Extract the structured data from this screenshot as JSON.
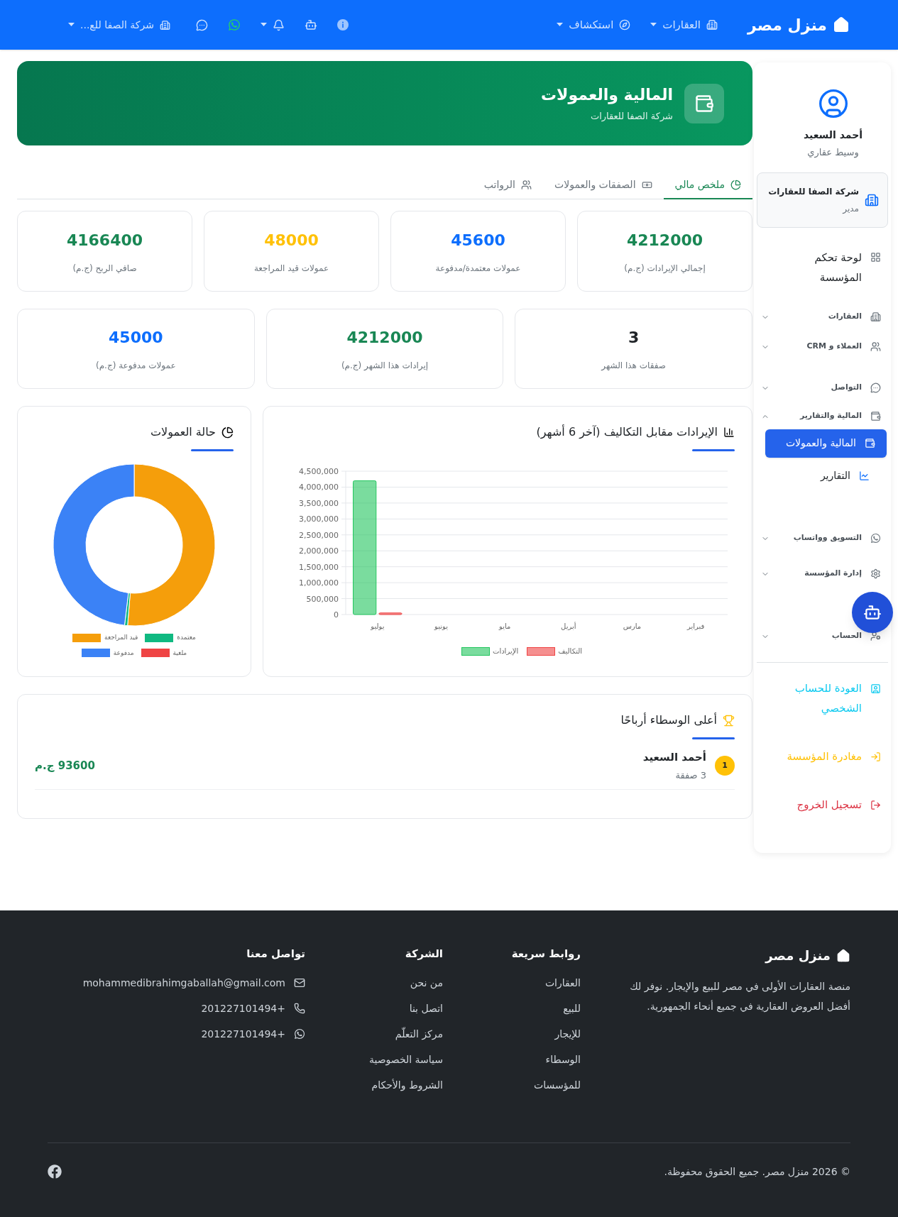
{
  "navbar": {
    "brand": "منزل مصر",
    "links": [
      {
        "label": "العقارات",
        "kind": "dropdown"
      },
      {
        "label": "استكشاف",
        "kind": "dropdown"
      }
    ],
    "company_menu": {
      "label": "شركة الصفا للع..."
    }
  },
  "sidebar": {
    "user": {
      "name": "أحمد السعيد",
      "role": "وسيط عقاري"
    },
    "company": {
      "name": "شركة الصفا للعقارات",
      "role": "مدير"
    },
    "items": [
      {
        "kind": "link",
        "label": "لوحة تحكم المؤسسة"
      },
      {
        "kind": "group",
        "label": "العقارات",
        "expanded": false
      },
      {
        "kind": "group",
        "label": "العملاء و CRM",
        "expanded": false
      },
      {
        "kind": "group",
        "label": "التواصل",
        "expanded": false
      },
      {
        "kind": "group",
        "label": "المالية والتقارير",
        "expanded": true,
        "children": [
          {
            "label": "المالية والعمولات",
            "selected": true
          },
          {
            "label": "التقارير",
            "selected": false
          }
        ]
      },
      {
        "kind": "group",
        "label": "التسويق وواتساب",
        "expanded": false
      },
      {
        "kind": "group",
        "label": "إدارة المؤسسة",
        "expanded": false
      },
      {
        "kind": "group",
        "label": "الحساب",
        "expanded": false
      }
    ],
    "actions": [
      {
        "label": "العودة للحساب الشخصي",
        "color": "#0dcaf0"
      },
      {
        "label": "مغادرة المؤسسة",
        "color": "#ffc107"
      },
      {
        "label": "تسجيل الخروج",
        "color": "#dc3545"
      }
    ]
  },
  "header": {
    "title": "المالية والعمولات",
    "subtitle": "شركة الصفا للعقارات"
  },
  "tabs": [
    {
      "label": "ملخص مالي",
      "selected": true
    },
    {
      "label": "الصفقات والعمولات",
      "selected": false
    },
    {
      "label": "الرواتب",
      "selected": false
    }
  ],
  "stats_row_1": [
    {
      "value": "4212000",
      "label": "إجمالي الإيرادات (ج.م)",
      "color": "#198754"
    },
    {
      "value": "45600",
      "label": "عمولات معتمدة/مدفوعة",
      "color": "#0d6efd"
    },
    {
      "value": "48000",
      "label": "عمولات قيد المراجعة",
      "color": "#ffc107"
    },
    {
      "value": "4166400",
      "label": "صافي الربح (ج.م)",
      "color": "#198754"
    }
  ],
  "stats_row_2": [
    {
      "value": "3",
      "label": "صفقات هذا الشهر",
      "color": "#212529"
    },
    {
      "value": "4212000",
      "label": "إيرادات هذا الشهر (ج.م)",
      "color": "#198754"
    },
    {
      "value": "45000",
      "label": "عمولات مدفوعة (ج.م)",
      "color": "#0d6efd"
    }
  ],
  "revenue_chart": {
    "title": "الإيرادات مقابل التكاليف (آخر 6 أشهر)",
    "chart_data": {
      "type": "bar",
      "categories": [
        "يوليو",
        "يونيو",
        "مايو",
        "أبريل",
        "مارس",
        "فبراير"
      ],
      "series": [
        {
          "name": "الإيرادات",
          "color": "#22c55e",
          "values": [
            4200000,
            0,
            0,
            0,
            0,
            0
          ]
        },
        {
          "name": "التكاليف",
          "color": "#ef4444",
          "values": [
            50000,
            0,
            0,
            0,
            0,
            0
          ]
        }
      ],
      "ylim": [
        0,
        4500000
      ],
      "grid": true,
      "legend": "bottom",
      "yticks": [
        {
          "value": 0,
          "label": "0"
        },
        {
          "value": 500000,
          "label": "500,000"
        },
        {
          "value": 1000000,
          "label": "1,000,000"
        },
        {
          "value": 1500000,
          "label": "1,500,000"
        },
        {
          "value": 2000000,
          "label": "2,000,000"
        },
        {
          "value": 2500000,
          "label": "2,500,000"
        },
        {
          "value": 3000000,
          "label": "3,000,000"
        },
        {
          "value": 3500000,
          "label": "3,500,000"
        },
        {
          "value": 4000000,
          "label": "4,000,000"
        },
        {
          "value": 4500000,
          "label": "4,500,000"
        }
      ]
    }
  },
  "commission_chart": {
    "title": "حالة العمولات",
    "chart_data": {
      "type": "donut",
      "categories": [
        "قيد المراجعة",
        "معتمدة",
        "مدفوعة",
        "ملغية"
      ],
      "series": [
        {
          "values": [
            51.3,
            0.6,
            48.1,
            0
          ]
        }
      ],
      "colors": [
        "#f59e0b",
        "#10b981",
        "#3b82f6",
        "#ef4444"
      ],
      "legend": "bottom"
    }
  },
  "top_brokers": {
    "title": "أعلى الوسطاء أرباحًا",
    "rows": [
      {
        "rank": "1",
        "name": "أحمد السعيد",
        "deals": "3 صفقة",
        "amount": "93600 ج.م"
      }
    ]
  },
  "footer": {
    "brand": "منزل مصر",
    "description": "منصة العقارات الأولى في مصر للبيع والإيجار. نوفر لك أفضل العروض العقارية في جميع أنحاء الجمهورية.",
    "columns": [
      {
        "title": "روابط سريعة",
        "links": [
          "العقارات",
          "للبيع",
          "للإيجار",
          "الوسطاء",
          "للمؤسسات"
        ]
      },
      {
        "title": "الشركة",
        "links": [
          "من نحن",
          "اتصل بنا",
          "مركز التعلّم",
          "سياسة الخصوصية",
          "الشروط والأحكام"
        ]
      }
    ],
    "contact": {
      "title": "تواصل معنا",
      "items": [
        {
          "kind": "email",
          "text": "mohammedibrahimgaballah@gmail.com"
        },
        {
          "kind": "phone",
          "text": "201227101494+"
        },
        {
          "kind": "whatsapp",
          "text": "201227101494+"
        }
      ]
    },
    "copyright": "© 2026 منزل مصر. جميع الحقوق محفوظة."
  }
}
